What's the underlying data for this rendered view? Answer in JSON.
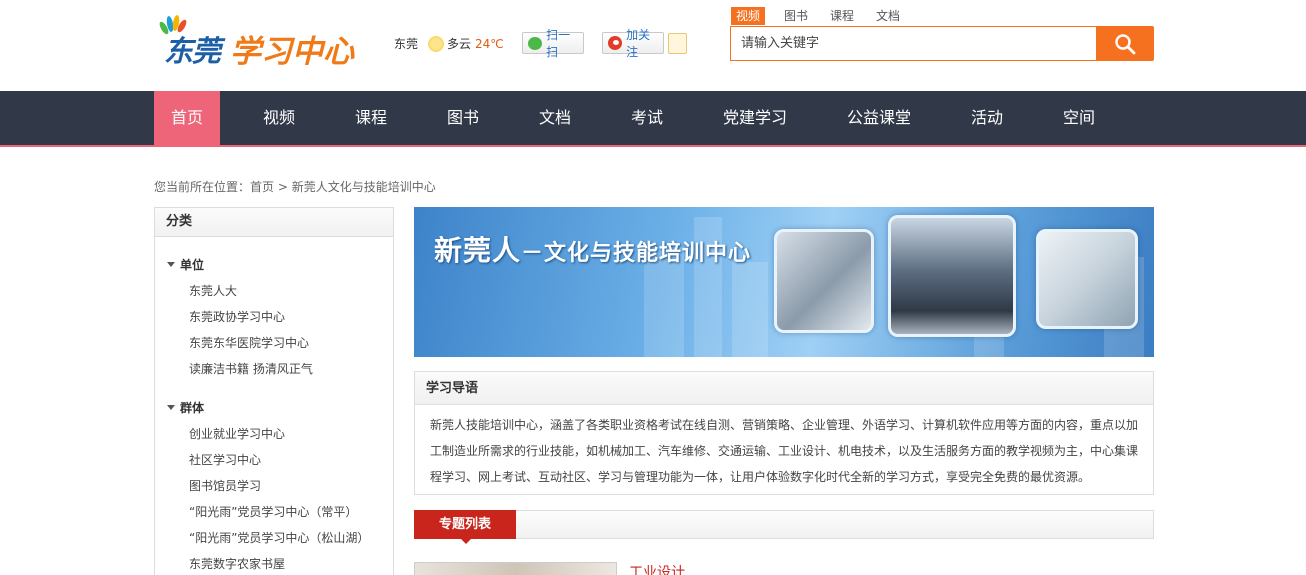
{
  "header": {
    "logo_part1": "东莞",
    "logo_part2": "学习中心",
    "weather": {
      "city": "东莞",
      "condition": "多云",
      "temp": "24℃"
    },
    "scan_label": "扫一扫",
    "follow_label": "加关注",
    "search_tabs": [
      "视频",
      "图书",
      "课程",
      "文档"
    ],
    "search_placeholder": "请输入关键字"
  },
  "nav": {
    "items": [
      "首页",
      "视频",
      "课程",
      "图书",
      "文档",
      "考试",
      "党建学习",
      "公益课堂",
      "活动",
      "空间"
    ]
  },
  "breadcrumb": {
    "prefix": "您当前所在位置：",
    "home": "首页",
    "sep": " > ",
    "current": "新莞人文化与技能培训中心"
  },
  "sidebar": {
    "title": "分类",
    "groups": [
      {
        "label": "单位",
        "items": [
          "东莞人大",
          "东莞政协学习中心",
          "东莞东华医院学习中心",
          "读廉洁书籍 扬清风正气"
        ]
      },
      {
        "label": "群体",
        "items": [
          "创业就业学习中心",
          "社区学习中心",
          "图书馆员学习",
          "“阳光雨”党员学习中心（常平）",
          "“阳光雨”党员学习中心（松山湖）",
          "东莞数字农家书屋"
        ]
      }
    ]
  },
  "banner": {
    "title_main": "新莞人",
    "title_sub": "－文化与技能培训中心"
  },
  "intro": {
    "title": "学习导语",
    "text": "新莞人技能培训中心，涵盖了各类职业资格考试在线自测、营销策略、企业管理、外语学习、计算机软件应用等方面的内容，重点以加工制造业所需求的行业技能，如机械加工、汽车维修、交通运输、工业设计、机电技术，以及生活服务方面的教学视频为主，中心集课程学习、网上考试、互动社区、学习与管理功能为一体，让用户体验数字化时代全新的学习方式，享受完全免费的最优资源。"
  },
  "special": {
    "tab_label": "专题列表",
    "first_item": "工业设计"
  },
  "colors": {
    "accent_orange": "#f5701f",
    "nav_bg": "#313848",
    "nav_active": "#ee6478",
    "list_red": "#c9251c"
  }
}
